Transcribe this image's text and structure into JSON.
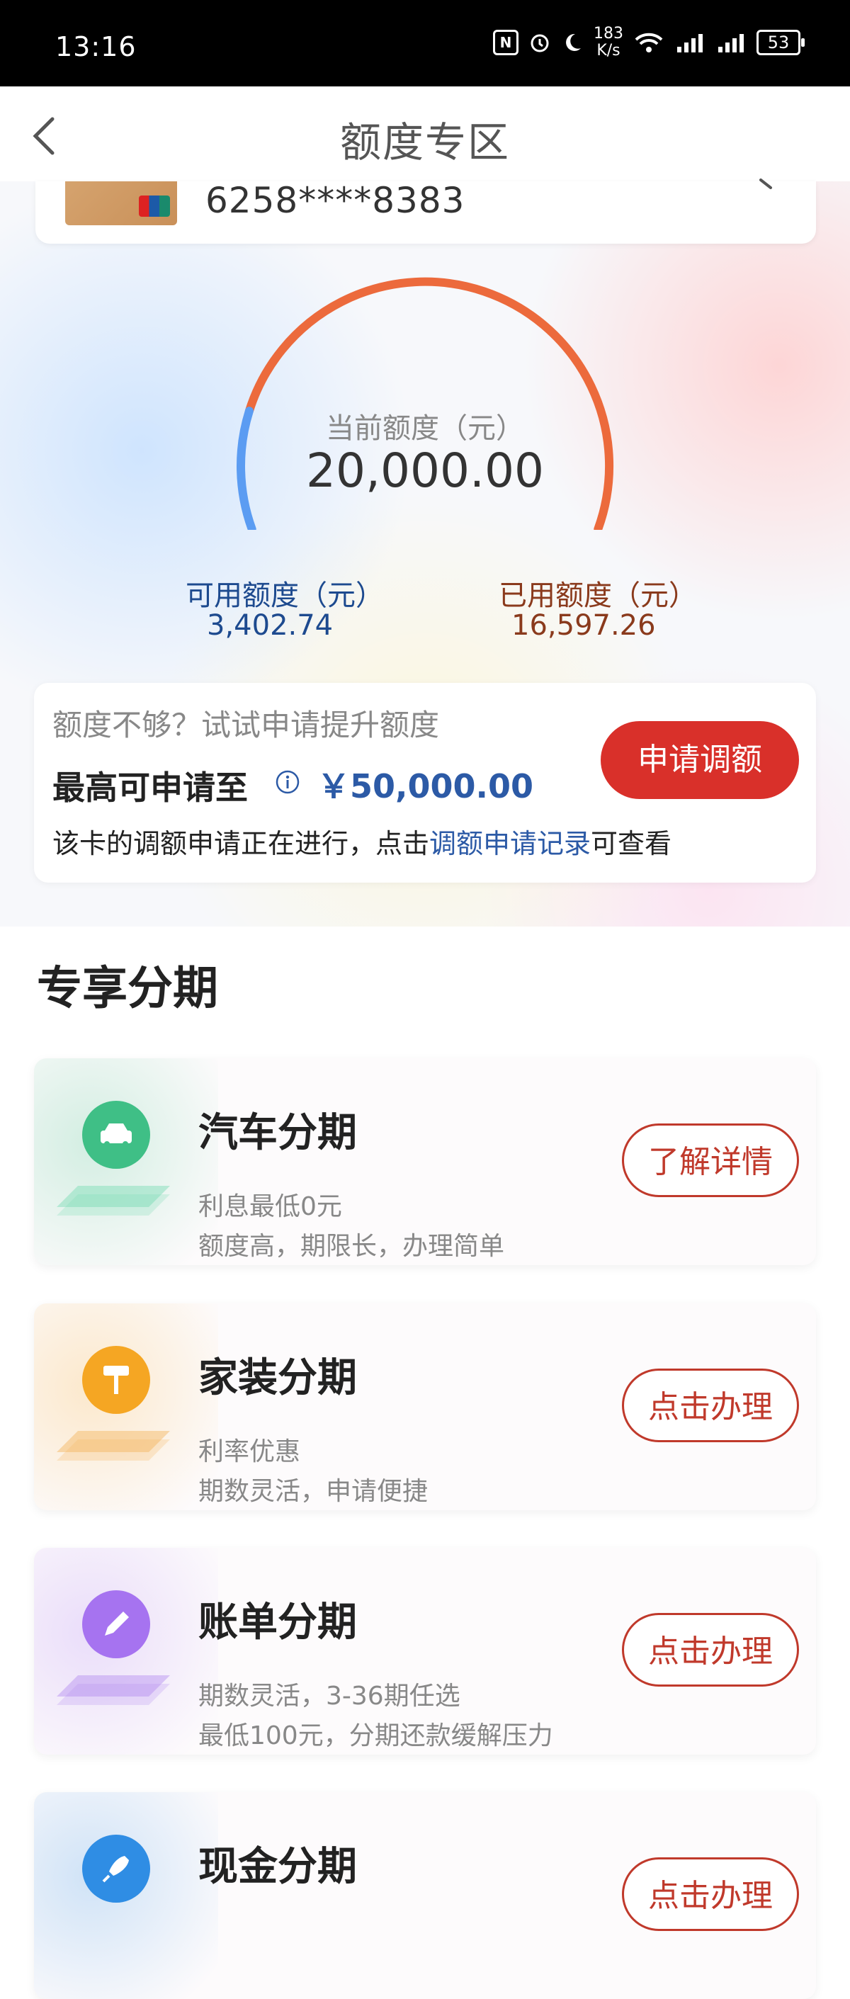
{
  "status_bar": {
    "time": "13:16",
    "network_speed_top": "183",
    "network_speed_unit": "K/s",
    "battery": "53"
  },
  "header": {
    "title": "额度专区"
  },
  "card": {
    "number": "6258****8383"
  },
  "quota": {
    "current_label": "当前额度（元）",
    "current_value": "20,000.00",
    "available_label": "可用额度（元）",
    "available_value": "3,402.74",
    "used_label": "已用额度（元）",
    "used_value": "16,597.26",
    "available_fraction": 0.17,
    "colors": {
      "available": "#5b9cf2",
      "used": "#ec6a3c"
    }
  },
  "raise": {
    "hint": "额度不够？试试申请提升额度",
    "max_label": "最高可申请至",
    "max_amount": "￥50,000.00",
    "note_prefix": "该卡的调额申请正在进行，点击",
    "note_link": "调额申请记录",
    "note_suffix": "可查看",
    "apply_button": "申请调额"
  },
  "section": {
    "title": "专享分期"
  },
  "installments": [
    {
      "title": "汽车分期",
      "desc1": "利息最低0元",
      "desc2": "额度高，期限长，办理简单",
      "button": "了解详情",
      "icon": "car-icon",
      "color": "#3fbf86"
    },
    {
      "title": "家装分期",
      "desc1": "利率优惠",
      "desc2": "期数灵活，申请便捷",
      "button": "点击办理",
      "icon": "paint-roller-icon",
      "color": "#f5a623"
    },
    {
      "title": "账单分期",
      "desc1": "期数灵活，3-36期任选",
      "desc2": "最低100元，分期还款缓解压力",
      "button": "点击办理",
      "icon": "pen-icon",
      "color": "#a673f0"
    },
    {
      "title": "现金分期",
      "desc1": "",
      "desc2": "",
      "button": "点击办理",
      "icon": "rocket-icon",
      "color": "#2f8de4"
    }
  ]
}
